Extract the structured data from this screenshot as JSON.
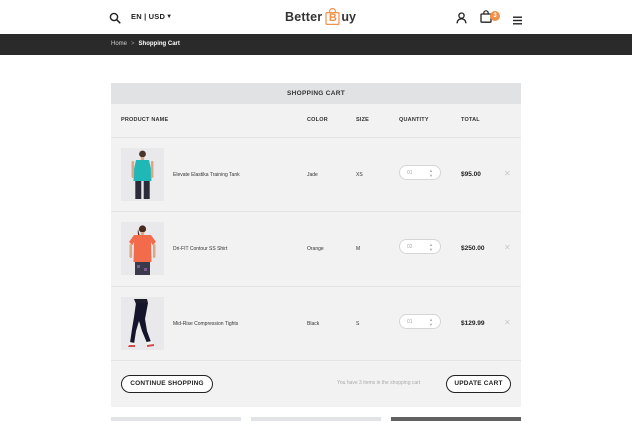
{
  "header": {
    "language_currency": "EN | USD",
    "logo": {
      "word1": "Better",
      "bag_letter": "B",
      "word2": "uy"
    },
    "cart_count": "3",
    "brand_color": "#f0914a"
  },
  "breadcrumb": {
    "home": "Home",
    "separator": ">",
    "current": "Shopping Cart"
  },
  "cart": {
    "title": "SHOPPING CART",
    "columns": {
      "product_name": "PRODUCT NAME",
      "color": "COLOR",
      "size": "SIZE",
      "quantity": "QUANTITY",
      "total": "TOTAL"
    },
    "items": [
      {
        "name": "Elevate Elastika Training Tank",
        "color": "Jade",
        "size": "XS",
        "quantity": "01",
        "total": "$95.00",
        "remove": "✕"
      },
      {
        "name": "Dri-FIT Contour SS Shirt",
        "color": "Orange",
        "size": "M",
        "quantity": "02",
        "total": "$250.00",
        "remove": "✕"
      },
      {
        "name": "Mid-Rise Compression Tights",
        "color": "Black",
        "size": "S",
        "quantity": "01",
        "total": "$129.99",
        "remove": "✕"
      }
    ],
    "items_note": "You have 3 items in the shopping cart",
    "continue_label": "CONTINUE SHOPPING",
    "update_label": "UPDATE CART"
  },
  "icons": {
    "search": "search-icon",
    "chevron": "chevron-down-icon",
    "user": "user-icon",
    "cart": "shopping-bag-icon",
    "menu": "hamburger-menu-icon",
    "quantity_up": "chevron-up-icon",
    "quantity_down": "chevron-down-icon",
    "remove": "close-icon"
  }
}
